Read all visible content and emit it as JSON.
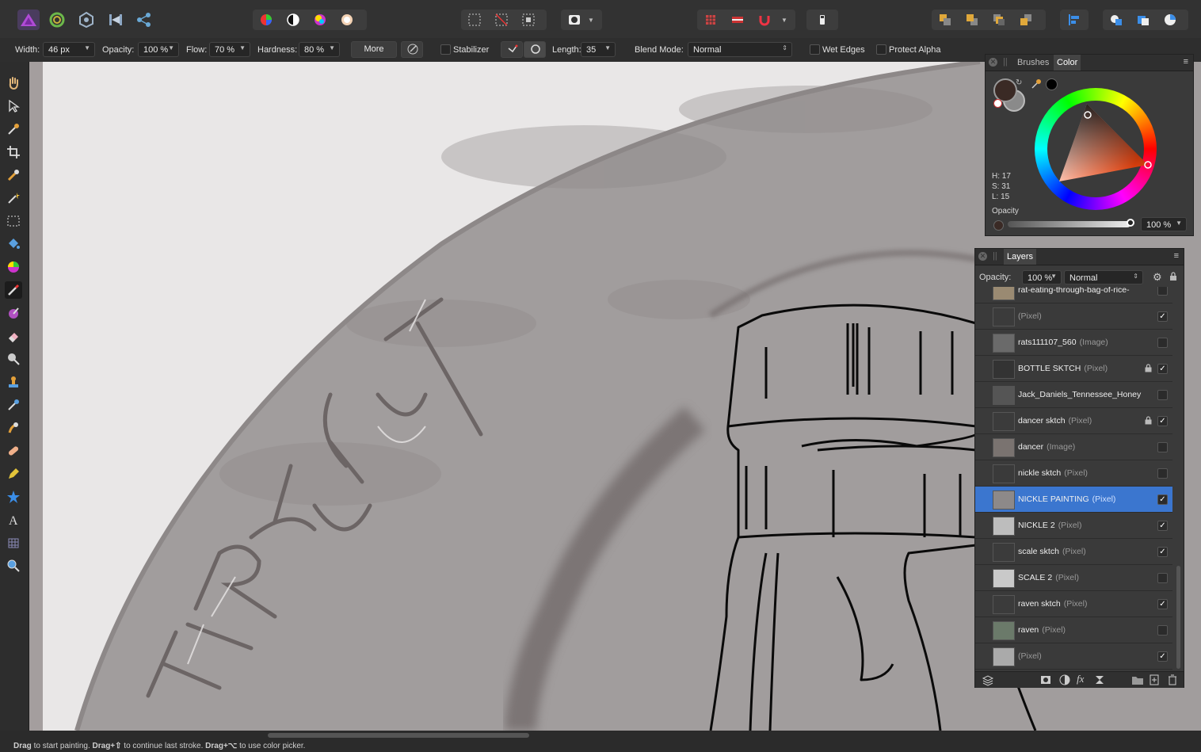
{
  "context_bar": {
    "width_label": "Width:",
    "width_value": "46 px",
    "opacity_label": "Opacity:",
    "opacity_value": "100 %",
    "flow_label": "Flow:",
    "flow_value": "70 %",
    "hardness_label": "Hardness:",
    "hardness_value": "80 %",
    "more_label": "More",
    "stabilizer_label": "Stabilizer",
    "length_label": "Length:",
    "length_value": "35",
    "blend_label": "Blend Mode:",
    "blend_value": "Normal",
    "wet_edges_label": "Wet Edges",
    "protect_alpha_label": "Protect Alpha"
  },
  "color_panel": {
    "tab_brushes": "Brushes",
    "tab_color": "Color",
    "h": "H: 17",
    "s": "S: 31",
    "l": "L: 15",
    "opacity_label": "Opacity",
    "opacity_value": "100 %",
    "primary_color": "#3a2a25",
    "secondary_color": "#8a8a8a"
  },
  "layers_panel": {
    "tab": "Layers",
    "opacity_label": "Opacity:",
    "opacity_value": "100 %",
    "blend_value": "Normal",
    "layers": [
      {
        "name": "rat-eating-through-bag-of-rice-",
        "type": "",
        "visible": false,
        "locked": false,
        "selected": false
      },
      {
        "name": "",
        "type": "(Pixel)",
        "visible": true,
        "locked": false,
        "selected": false
      },
      {
        "name": "rats111107_560",
        "type": "(Image)",
        "visible": false,
        "locked": false,
        "selected": false
      },
      {
        "name": "BOTTLE SKTCH",
        "type": "(Pixel)",
        "visible": true,
        "locked": true,
        "selected": false
      },
      {
        "name": "Jack_Daniels_Tennessee_Honey",
        "type": "",
        "visible": false,
        "locked": false,
        "selected": false
      },
      {
        "name": "dancer sktch",
        "type": "(Pixel)",
        "visible": true,
        "locked": true,
        "selected": false
      },
      {
        "name": "dancer",
        "type": "(Image)",
        "visible": false,
        "locked": false,
        "selected": false
      },
      {
        "name": "nickle sktch",
        "type": "(Pixel)",
        "visible": false,
        "locked": false,
        "selected": false
      },
      {
        "name": "NICKLE PAINTING",
        "type": "(Pixel)",
        "visible": true,
        "locked": false,
        "selected": true
      },
      {
        "name": "NICKLE 2",
        "type": "(Pixel)",
        "visible": true,
        "locked": false,
        "selected": false
      },
      {
        "name": "scale sktch",
        "type": "(Pixel)",
        "visible": true,
        "locked": false,
        "selected": false
      },
      {
        "name": "SCALE 2",
        "type": "(Pixel)",
        "visible": false,
        "locked": false,
        "selected": false
      },
      {
        "name": "raven sktch",
        "type": "(Pixel)",
        "visible": true,
        "locked": false,
        "selected": false
      },
      {
        "name": "raven",
        "type": "(Pixel)",
        "visible": false,
        "locked": false,
        "selected": false
      },
      {
        "name": "",
        "type": "(Pixel)",
        "visible": true,
        "locked": false,
        "selected": false
      }
    ]
  },
  "status": {
    "part1_bold": "Drag",
    "part1": " to start painting. ",
    "part2_bold": "Drag+⇧",
    "part2": " to continue last stroke. ",
    "part3_bold": "Drag+⌥",
    "part3": " to use color picker."
  },
  "canvas": {
    "coin_text": "TRUST"
  },
  "colors": {
    "accent": "#3b76cf",
    "toolbar_bg": "#323232",
    "canvas_bg": "#e9e7e7",
    "coin": "#a19d9d"
  }
}
